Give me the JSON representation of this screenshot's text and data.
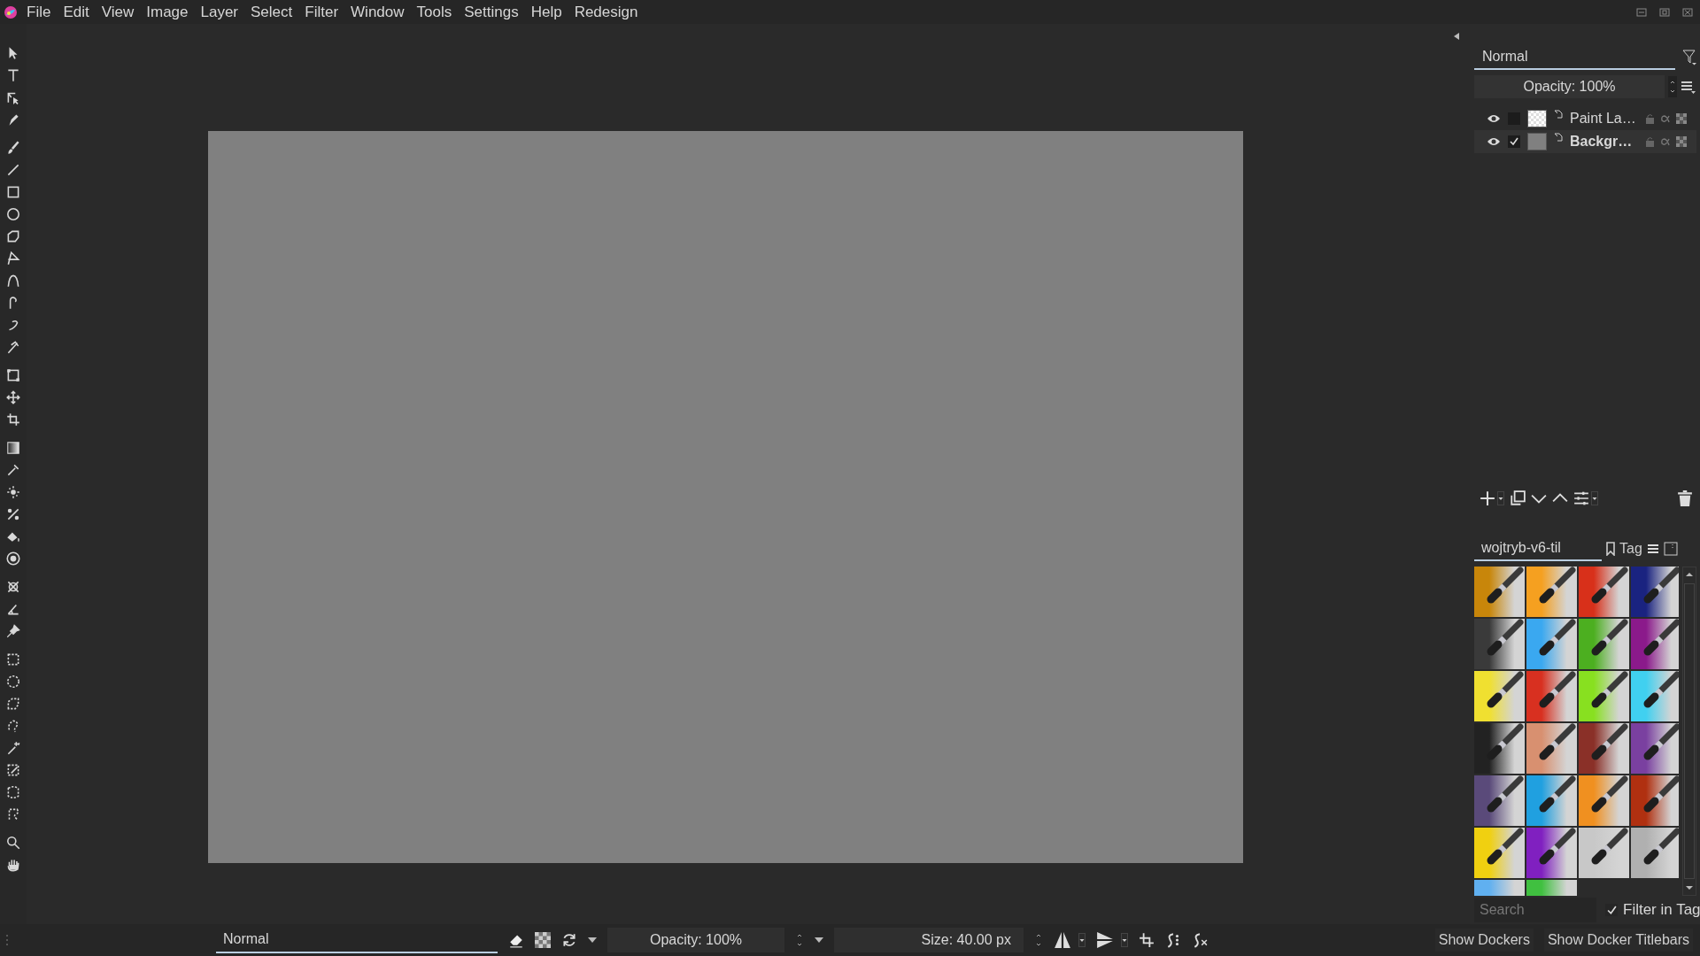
{
  "menu_bar": {
    "items": [
      "File",
      "Edit",
      "View",
      "Image",
      "Layer",
      "Select",
      "Filter",
      "Window",
      "Tools",
      "Settings",
      "Help",
      "Redesign"
    ]
  },
  "layers_docker": {
    "blend_mode": "Normal",
    "opacity": "Opacity: 100%",
    "layers": [
      {
        "name": "Paint La…",
        "visible": true,
        "checked": false,
        "selected": false,
        "transparent": true
      },
      {
        "name": "Backgr…",
        "visible": true,
        "checked": true,
        "selected": true,
        "transparent": false
      }
    ]
  },
  "brush_presets_docker": {
    "tag": "wojtryb-v6-til",
    "tag_button": "Tag",
    "presets": [
      {
        "color": "#c8860a"
      },
      {
        "color": "#f5a020"
      },
      {
        "color": "#d8301a"
      },
      {
        "color": "#1a2380"
      },
      {
        "color": "#3a3a3a"
      },
      {
        "color": "#3aa8f0"
      },
      {
        "color": "#4caf20"
      },
      {
        "color": "#8b1a8b"
      },
      {
        "color": "#f0e030"
      },
      {
        "color": "#d83020"
      },
      {
        "color": "#88e020"
      },
      {
        "color": "#40d0f0"
      },
      {
        "color": "#222222"
      },
      {
        "color": "#d89070"
      },
      {
        "color": "#8a3028"
      },
      {
        "color": "#7a40a0"
      },
      {
        "color": "#5a4a7a"
      },
      {
        "color": "#20a0e0"
      },
      {
        "color": "#f09020"
      },
      {
        "color": "#b03010"
      },
      {
        "color": "#f0d010"
      },
      {
        "color": "#8020c0"
      },
      {
        "color": "#c8c8c8"
      },
      {
        "color": "#b0b0b0"
      },
      {
        "color": "#60b0f0"
      },
      {
        "color": "#40c040"
      }
    ],
    "search": {
      "placeholder": "Search"
    },
    "filter_in_tag": {
      "label": "Filter in Tag",
      "checked": true
    }
  },
  "tool_options_bar": {
    "blend_mode": "Normal",
    "opacity": "Opacity: 100%",
    "size": "Size: 40.00 px",
    "buttons": [
      "Show Dockers",
      "Show Docker Titlebars"
    ]
  }
}
